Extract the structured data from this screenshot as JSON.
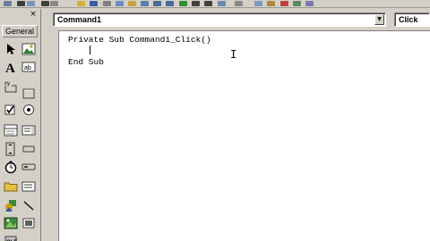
{
  "toolbar": {
    "buttons": [
      {
        "icon": "project-explorer-icon",
        "color": "#6a7f9e"
      },
      {
        "icon": "dropdown-arrow-icon",
        "color": "#404040"
      },
      {
        "icon": "add-form-icon",
        "color": "#7b94b8"
      },
      {
        "icon": "dropdown-arrow-icon",
        "color": "#404040"
      },
      {
        "icon": "menu-editor-icon",
        "color": "#8a8a8a"
      },
      {
        "icon": "open-project-icon",
        "color": "#d6b23a"
      },
      {
        "icon": "save-project-icon",
        "color": "#3a5ca8"
      },
      {
        "icon": "cut-icon",
        "color": "#808080"
      },
      {
        "icon": "copy-icon",
        "color": "#6c8cc0"
      },
      {
        "icon": "paste-icon",
        "color": "#c9a23a"
      },
      {
        "icon": "find-icon",
        "color": "#5a7fb0"
      },
      {
        "icon": "undo-icon",
        "color": "#4a6a9a"
      },
      {
        "icon": "redo-icon",
        "color": "#4a6a9a"
      },
      {
        "icon": "start-icon",
        "color": "#2f8f2f"
      },
      {
        "icon": "break-icon",
        "color": "#404040"
      },
      {
        "icon": "end-icon",
        "color": "#404040"
      },
      {
        "icon": "project-explorer-window-icon",
        "color": "#6a8ab0"
      },
      {
        "icon": "properties-window-icon",
        "color": "#8a8a8a"
      },
      {
        "icon": "form-layout-icon",
        "color": "#7a9ac0"
      },
      {
        "icon": "object-browser-icon",
        "color": "#b08a3a"
      },
      {
        "icon": "toolbox-icon",
        "color": "#c04040"
      },
      {
        "icon": "data-view-icon",
        "color": "#5a8a5a"
      },
      {
        "icon": "component-manager-icon",
        "color": "#7a7ab0"
      }
    ]
  },
  "toolbox": {
    "tab_label": "General",
    "close_glyph": "×",
    "tools": [
      {
        "name": "pointer-icon"
      },
      {
        "name": "picturebox-icon"
      },
      {
        "name": "label-icon"
      },
      {
        "name": "textbox-icon"
      },
      {
        "name": "frame-icon"
      },
      {
        "name": "commandbutton-icon"
      },
      {
        "name": "checkbox-icon"
      },
      {
        "name": "optionbutton-icon"
      },
      {
        "name": "combobox-icon"
      },
      {
        "name": "listbox-icon"
      },
      {
        "name": "hscrollbar-icon"
      },
      {
        "name": "vscrollbar-icon"
      },
      {
        "name": "timer-icon"
      },
      {
        "name": "drivelistbox-icon"
      },
      {
        "name": "dirlistbox-icon"
      },
      {
        "name": "filelistbox-icon"
      },
      {
        "name": "shape-icon"
      },
      {
        "name": "line-icon"
      },
      {
        "name": "image-icon"
      },
      {
        "name": "data-icon"
      },
      {
        "name": "ole-icon"
      }
    ]
  },
  "code_window": {
    "object_combo": "Command1",
    "procedure_combo": "Click",
    "code_lines": [
      "Private Sub Command1_Click()",
      "",
      "End Sub"
    ]
  }
}
